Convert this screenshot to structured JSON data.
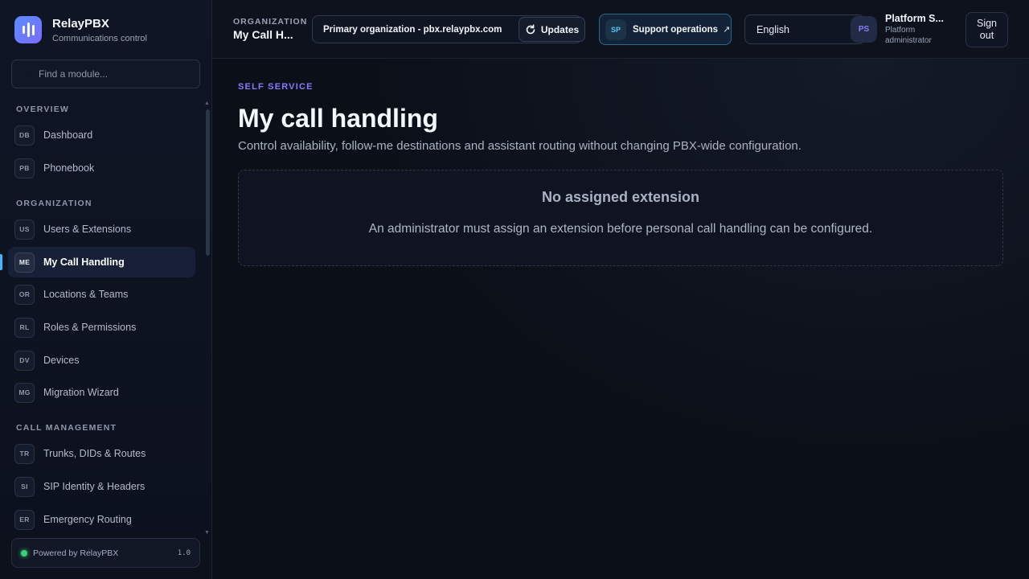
{
  "brand": {
    "name": "RelayPBX",
    "subtitle": "Communications control"
  },
  "search": {
    "placeholder": "Find a module..."
  },
  "sidebar": {
    "sections": [
      {
        "title": "OVERVIEW"
      },
      {
        "title": "ORGANIZATION"
      },
      {
        "title": "CALL MANAGEMENT"
      }
    ],
    "items": [
      {
        "badge": "DB",
        "label": "Dashboard"
      },
      {
        "badge": "PB",
        "label": "Phonebook"
      },
      {
        "badge": "US",
        "label": "Users & Extensions"
      },
      {
        "badge": "ME",
        "label": "My Call Handling",
        "active": true
      },
      {
        "badge": "OR",
        "label": "Locations & Teams"
      },
      {
        "badge": "RL",
        "label": "Roles & Permissions"
      },
      {
        "badge": "DV",
        "label": "Devices"
      },
      {
        "badge": "MG",
        "label": "Migration Wizard"
      },
      {
        "badge": "TR",
        "label": "Trunks, DIDs & Routes"
      },
      {
        "badge": "SI",
        "label": "SIP Identity & Headers"
      },
      {
        "badge": "ER",
        "label": "Emergency Routing"
      }
    ],
    "footer": {
      "powered": "Powered by RelayPBX",
      "version": "1.0",
      "status_color": "#3ad07a"
    }
  },
  "topbar": {
    "org_eyebrow": "ORGANIZATION",
    "org_name": "My Call H...",
    "org_select": "Primary organization - pbx.relaypbx.com",
    "updates": "Updates",
    "support_badge": "SP",
    "support_label": "Support operations",
    "language": "English",
    "avatar": "PS",
    "user_name": "Platform S...",
    "user_role": "Platform administrator",
    "signout": "Sign out"
  },
  "main": {
    "eyebrow": "SELF SERVICE",
    "title": "My call handling",
    "description": "Control availability, follow-me destinations and assistant routing without changing PBX-wide configuration.",
    "empty_title": "No assigned extension",
    "empty_desc": "An administrator must assign an extension before personal call handling can be configured."
  },
  "colors": {
    "accent": "#3fb6ff",
    "eyebrow": "#8a78ff",
    "support_border": "#2b6a84"
  }
}
